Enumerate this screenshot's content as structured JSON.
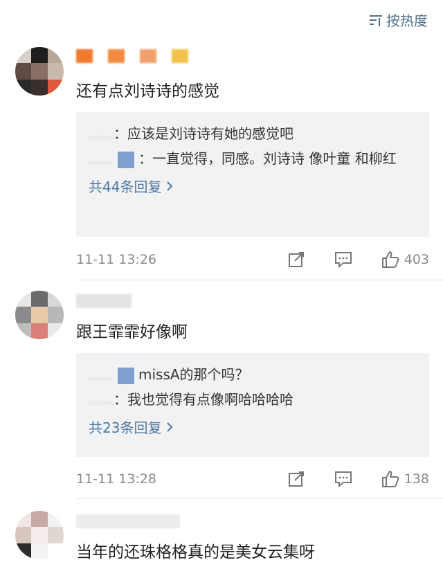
{
  "sort": {
    "label": "按热度"
  },
  "comments": [
    {
      "username_hidden": true,
      "avatar_colors": [
        "#d9d0c8",
        "#1e1e1e",
        "#b7a89a",
        "#5f4b44",
        "#8a6f66",
        "#c9b8ad",
        "#2a2a2a",
        "#3a2f2d",
        "#e0593c"
      ],
      "username_colors": [
        "#f07a2d",
        "#f28a3f",
        "#f0a06a",
        "#f2c24a"
      ],
      "text": "还有点刘诗诗的感觉",
      "replies": [
        {
          "user": "……",
          "content": "：应该是刘诗诗有她的感觉吧"
        },
        {
          "user": "……",
          "content": "：一直觉得，同感。刘诗诗 像叶童 和柳红"
        }
      ],
      "more_label": "共44条回复",
      "time": "11-11 13:26",
      "likes": "403"
    },
    {
      "username_hidden": true,
      "avatar_colors": [
        "#e6e6e6",
        "#6b6b6b",
        "#d8d8d8",
        "#8b8b8b",
        "#e8c9a8",
        "#b8b8b8",
        "#bdbdbd",
        "#d9807a",
        "#e9e9e9"
      ],
      "text": "跟王霏霏好像啊",
      "replies": [
        {
          "user": "……",
          "content": "missA的那个吗？"
        },
        {
          "user": "……",
          "content": "：我也觉得有点像啊哈哈哈哈"
        }
      ],
      "more_label": "共23条回复",
      "time": "11-11 13:28",
      "likes": "138"
    },
    {
      "username_hidden": true,
      "avatar_colors": [
        "#f0e6e6",
        "#c9a9a6",
        "#f2f2f2",
        "#d6c6bd",
        "#f4ecec",
        "#e0d6d0",
        "#2c2c2c",
        "#f3f3f3",
        "#ffffff"
      ],
      "text": "当年的还珠格格真的是美女云集呀"
    }
  ]
}
